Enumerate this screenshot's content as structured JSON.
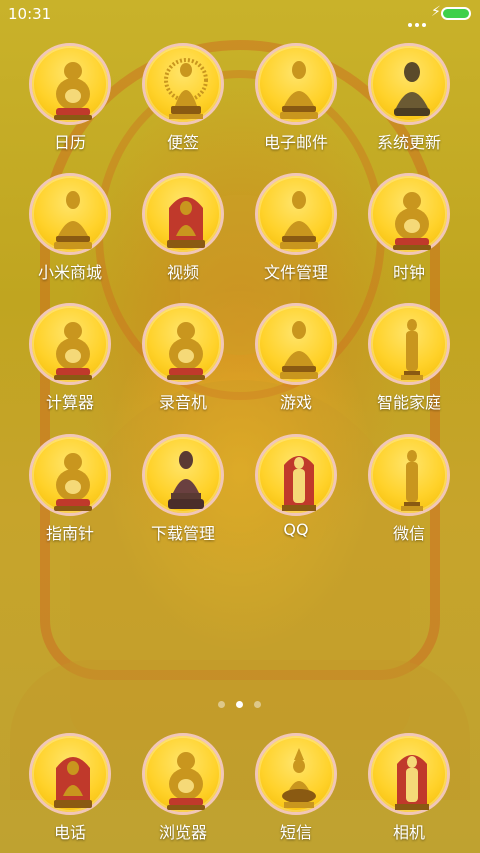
{
  "status": {
    "time": "10:31"
  },
  "grid": [
    {
      "label": "日历",
      "icon": "laughing-buddha-icon"
    },
    {
      "label": "便签",
      "icon": "thousand-arm-statue-icon"
    },
    {
      "label": "电子邮件",
      "icon": "seated-buddha-icon"
    },
    {
      "label": "系统更新",
      "icon": "bronze-buddha-icon"
    },
    {
      "label": "小米商城",
      "icon": "seated-buddha-icon"
    },
    {
      "label": "视频",
      "icon": "buddha-shrine-icon"
    },
    {
      "label": "文件管理",
      "icon": "seated-buddha-icon"
    },
    {
      "label": "时钟",
      "icon": "laughing-buddha-icon"
    },
    {
      "label": "计算器",
      "icon": "laughing-buddha-icon"
    },
    {
      "label": "录音机",
      "icon": "laughing-buddha-icon"
    },
    {
      "label": "游戏",
      "icon": "seated-buddha-icon"
    },
    {
      "label": "智能家庭",
      "icon": "standing-monk-icon"
    },
    {
      "label": "指南针",
      "icon": "laughing-buddha-icon"
    },
    {
      "label": "下载管理",
      "icon": "dark-buddha-icon"
    },
    {
      "label": "QQ",
      "icon": "standing-deity-shrine-icon"
    },
    {
      "label": "微信",
      "icon": "standing-monk-icon"
    }
  ],
  "dock": [
    {
      "label": "电话",
      "icon": "buddha-shrine-icon"
    },
    {
      "label": "浏览器",
      "icon": "laughing-buddha-icon"
    },
    {
      "label": "短信",
      "icon": "rider-deity-icon"
    },
    {
      "label": "相机",
      "icon": "standing-deity-shrine-icon"
    }
  ],
  "pager": {
    "count": 3,
    "active": 2
  },
  "colors": {
    "icon_gold": "#ffd22a",
    "icon_ring": "#f1c7b8",
    "battery": "#3fd04a",
    "label": "#ffffff"
  }
}
